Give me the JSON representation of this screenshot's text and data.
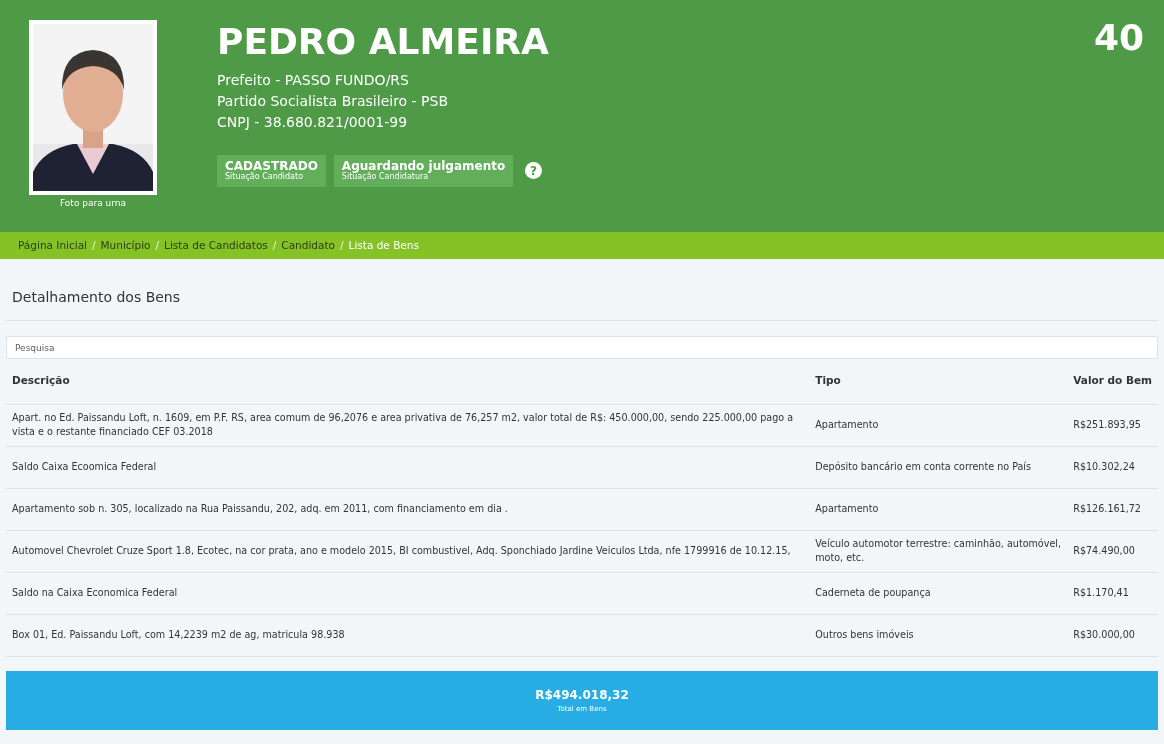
{
  "candidate": {
    "photo": {
      "kind": "picture",
      "caption": "Foto para urna"
    },
    "name": "PEDRO ALMEIRA",
    "number": "40",
    "details": [
      "Prefeito - PASSO FUNDO/RS",
      "Partido Socialista Brasileiro - PSB",
      "CNPJ - 38.680.821/0001-99"
    ],
    "statuses": [
      {
        "value": "CADASTRADO",
        "label": "Situação Candidato"
      },
      {
        "value": "Aguardando julgamento",
        "label": "Situação Candidatura"
      }
    ],
    "help_icon": "?"
  },
  "breadcrumb_separator": "/",
  "breadcrumb": [
    {
      "label": "Página Inicial",
      "selected": false
    },
    {
      "label": "Município",
      "selected": false
    },
    {
      "label": "Lista de Candidatos",
      "selected": false
    },
    {
      "label": "Candidato",
      "selected": false
    },
    {
      "label": "Lista de Bens",
      "selected": true
    }
  ],
  "section_title": "Detalhamento dos Bens",
  "search": {
    "placeholder": "Pesquisa"
  },
  "table": {
    "columns": [
      "Descrição",
      "Tipo",
      "Valor do Bem"
    ],
    "rows": [
      [
        "Apart. no Ed. Paissandu Loft, n. 1609, em P.F. RS, area comum de 96,2076 e area privativa de 76,257 m2, valor total de R$: 450.000,00, sendo 225.000,00 pago a vista e o restante financiado CEF 03.2018",
        "Apartamento",
        "R$251.893,95"
      ],
      [
        "Saldo Caixa Ecoomica Federal",
        "Depósito bancário em conta corrente no País",
        "R$10.302,24"
      ],
      [
        "Apartamento sob n. 305, localizado na Rua Paissandu, 202, adq. em 2011, com financiamento em dia .",
        "Apartamento",
        "R$126.161,72"
      ],
      [
        "Automovel Chevrolet Cruze Sport 1.8, Ecotec, na cor prata, ano e modelo 2015, BI combustivel, Adq. Sponchiado Jardine Veiculos Ltda, nfe 1799916 de 10.12.15,",
        "Veículo automotor terrestre: caminhão, automóvel, moto, etc.",
        "R$74.490,00"
      ],
      [
        "Saldo na Caixa Economica Federal",
        "Caderneta de poupança",
        "R$1.170,41"
      ],
      [
        "Box 01, Ed. Paissandu Loft, com 14,2239 m2 de ag, matricula 98.938",
        "Outros bens imóveis",
        "R$30.000,00"
      ]
    ]
  },
  "total": {
    "value": "R$494.018,32",
    "label": "Total em Bens"
  }
}
